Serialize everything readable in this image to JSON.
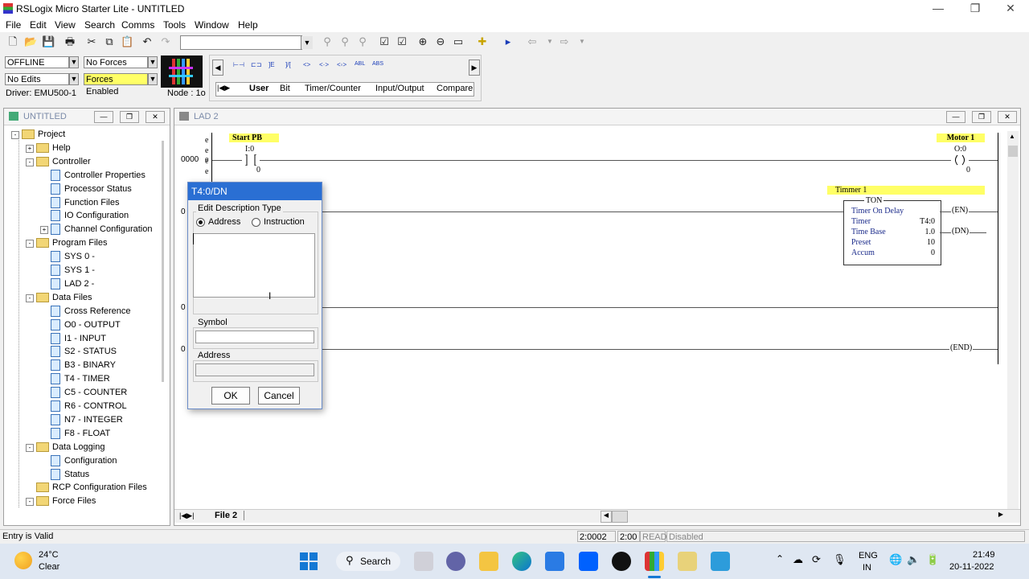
{
  "app": {
    "title": "RSLogix Micro Starter Lite - UNTITLED",
    "colors": {
      "accent": "#2a6fd3",
      "forces_enabled_bg": "#ffff66",
      "label_bg": "#ffff66"
    }
  },
  "menu": [
    "File",
    "Edit",
    "View",
    "Search",
    "Comms",
    "Tools",
    "Window",
    "Help"
  ],
  "status_panel": {
    "mode": "OFFLINE",
    "forces": "No Forces",
    "edits": "No Edits",
    "forces_enabled": "Forces Enabled",
    "driver": "Driver: EMU500-1",
    "node": "Node : 1o"
  },
  "instruction_tabs": [
    "User",
    "Bit",
    "Timer/Counter",
    "Input/Output",
    "Compare"
  ],
  "instruction_icons": [
    "⊢⊣",
    "⊏⊐",
    "]E",
    "]/[",
    "<>",
    "<·>",
    "<◦>",
    "ABL",
    "ABS"
  ],
  "project_pane": {
    "title": "UNTITLED",
    "tree": [
      {
        "label": "Project",
        "level": 0,
        "type": "folder",
        "expander": "-"
      },
      {
        "label": "Help",
        "level": 1,
        "type": "folder",
        "expander": "+"
      },
      {
        "label": "Controller",
        "level": 1,
        "type": "folder",
        "expander": "-"
      },
      {
        "label": "Controller Properties",
        "level": 2,
        "type": "file"
      },
      {
        "label": "Processor Status",
        "level": 2,
        "type": "file"
      },
      {
        "label": "Function Files",
        "level": 2,
        "type": "file"
      },
      {
        "label": "IO Configuration",
        "level": 2,
        "type": "file"
      },
      {
        "label": "Channel Configuration",
        "level": 2,
        "type": "file",
        "expander": "+"
      },
      {
        "label": "Program Files",
        "level": 1,
        "type": "folder",
        "expander": "-"
      },
      {
        "label": "SYS 0 -",
        "level": 2,
        "type": "file"
      },
      {
        "label": "SYS 1 -",
        "level": 2,
        "type": "file"
      },
      {
        "label": "LAD 2 -",
        "level": 2,
        "type": "file"
      },
      {
        "label": "Data Files",
        "level": 1,
        "type": "folder",
        "expander": "-"
      },
      {
        "label": "Cross Reference",
        "level": 2,
        "type": "file"
      },
      {
        "label": "O0 - OUTPUT",
        "level": 2,
        "type": "file"
      },
      {
        "label": "I1 - INPUT",
        "level": 2,
        "type": "file"
      },
      {
        "label": "S2 - STATUS",
        "level": 2,
        "type": "file"
      },
      {
        "label": "B3 - BINARY",
        "level": 2,
        "type": "file"
      },
      {
        "label": "T4 - TIMER",
        "level": 2,
        "type": "file"
      },
      {
        "label": "C5 - COUNTER",
        "level": 2,
        "type": "file"
      },
      {
        "label": "R6 - CONTROL",
        "level": 2,
        "type": "file"
      },
      {
        "label": "N7 - INTEGER",
        "level": 2,
        "type": "file"
      },
      {
        "label": "F8 - FLOAT",
        "level": 2,
        "type": "file"
      },
      {
        "label": "Data Logging",
        "level": 1,
        "type": "folder",
        "expander": "-"
      },
      {
        "label": "Configuration",
        "level": 2,
        "type": "file"
      },
      {
        "label": "Status",
        "level": 2,
        "type": "file"
      },
      {
        "label": "RCP Configuration Files",
        "level": 1,
        "type": "folder"
      },
      {
        "label": "Force Files",
        "level": 1,
        "type": "folder",
        "expander": "-"
      }
    ]
  },
  "ladder_pane": {
    "title": "LAD 2",
    "file_tab": "File 2",
    "rung0": {
      "number": "0000",
      "contact_label": "Start PB",
      "contact_address": "I:0",
      "contact_bit": "0",
      "coil_label": "Motor 1",
      "coil_address": "O:0",
      "coil_bit": "0"
    },
    "rung1": {
      "number_partial": "0",
      "timer_label": "Timmer 1",
      "block_title": "TON",
      "rows": [
        {
          "k": "Timer On Delay",
          "v": ""
        },
        {
          "k": "Timer",
          "v": "T4:0"
        },
        {
          "k": "Time Base",
          "v": "1.0"
        },
        {
          "k": "Preset",
          "v": "10"
        },
        {
          "k": "Accum",
          "v": "0"
        }
      ],
      "en": "EN",
      "dn": "DN"
    },
    "rung2": {
      "number_partial": "0"
    },
    "rung3": {
      "number_partial": "0",
      "end": "END"
    },
    "e_marks": [
      "e",
      "e",
      "e",
      "e",
      "e"
    ]
  },
  "dialog": {
    "title": "T4:0/DN",
    "group_title": "Edit Description Type",
    "opt_address": "Address",
    "opt_instruction": "Instruction",
    "selected": "Address",
    "description_value": "",
    "symbol_label": "Symbol",
    "symbol_value": "",
    "address_label": "Address",
    "address_value": "",
    "ok": "OK",
    "cancel": "Cancel"
  },
  "statusbar": {
    "message": "Entry is Valid",
    "pos": "2:0002",
    "rung": "2:00",
    "read": "READ",
    "disabled": "Disabled"
  },
  "taskbar": {
    "weather_temp": "24°C",
    "weather_desc": "Clear",
    "search": "Search",
    "lang1": "ENG",
    "lang2": "IN",
    "time": "21:49",
    "date": "20-11-2022"
  }
}
